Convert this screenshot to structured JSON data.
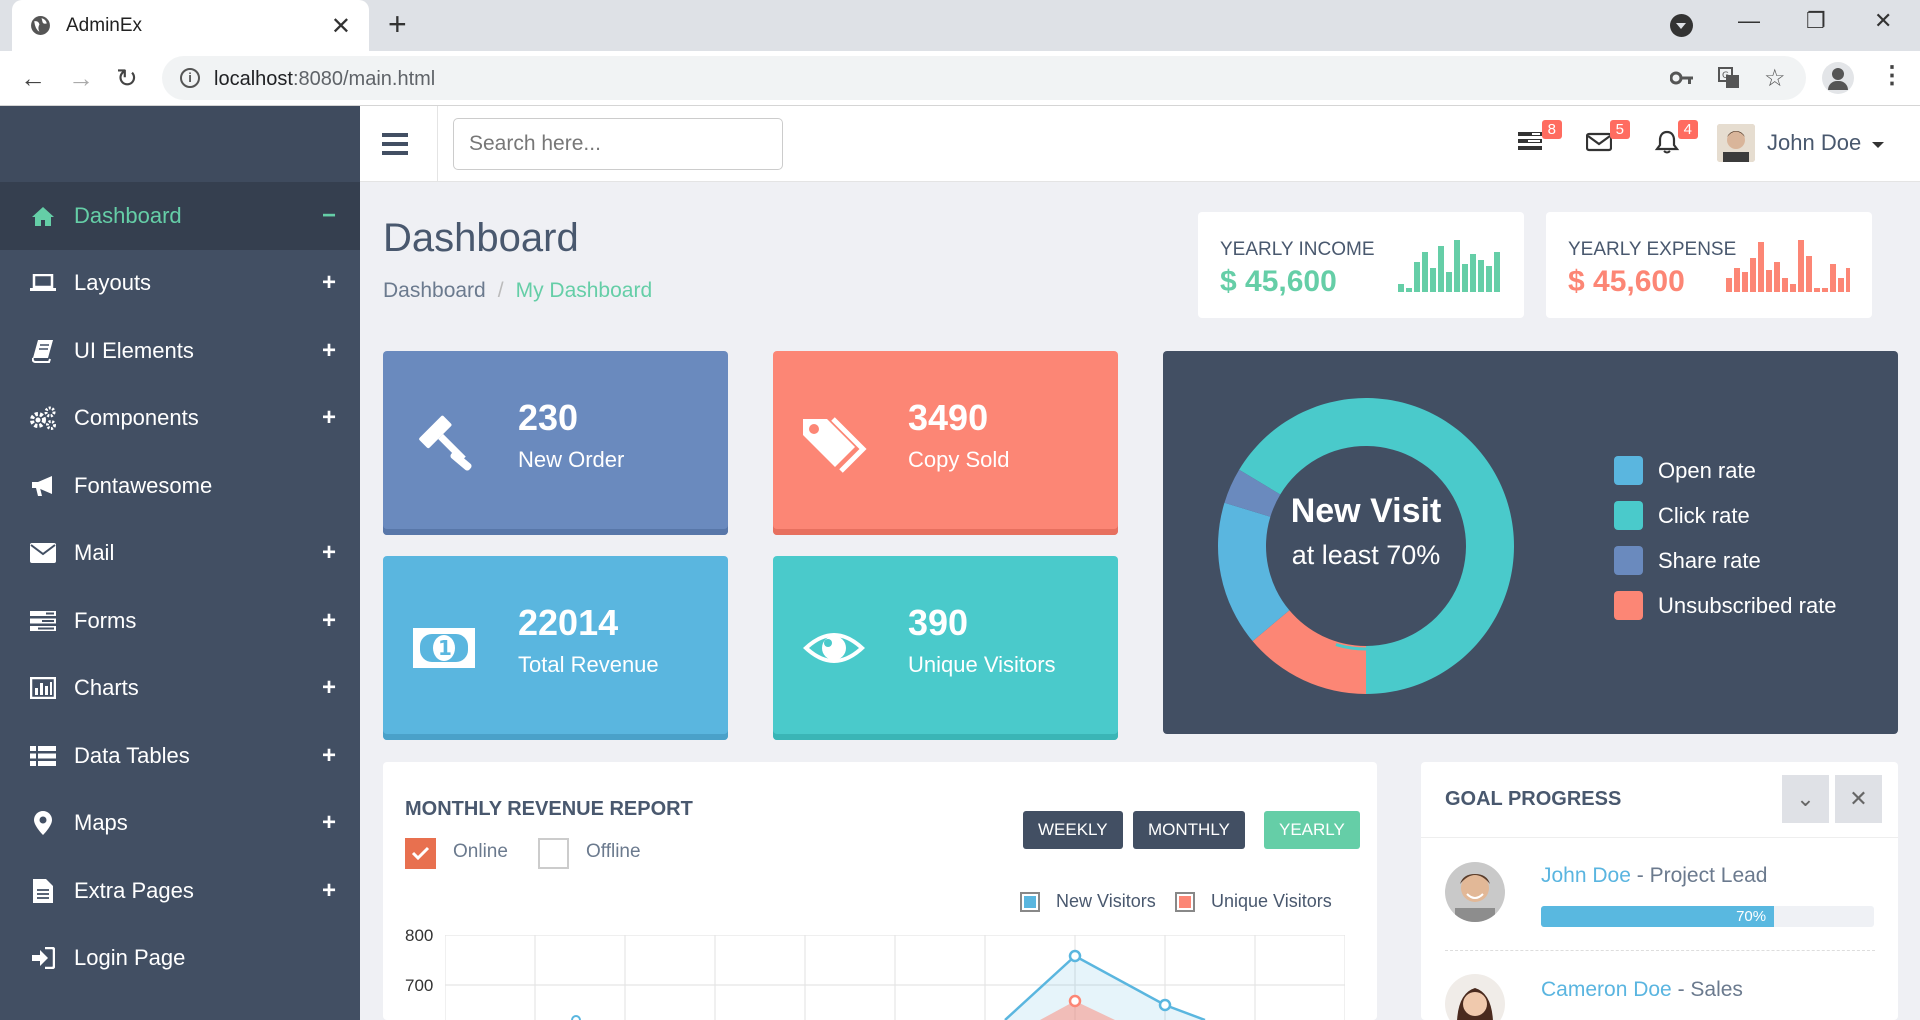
{
  "browser": {
    "tab_title": "AdminEx",
    "url_host": "localhost",
    "url_path": ":8080/main.html"
  },
  "sidebar": {
    "items": [
      {
        "label": "Dashboard",
        "icon": "home-icon",
        "toggle": "−"
      },
      {
        "label": "Layouts",
        "icon": "laptop-icon",
        "toggle": "+"
      },
      {
        "label": "UI Elements",
        "icon": "book-icon",
        "toggle": "+"
      },
      {
        "label": "Components",
        "icon": "cogs-icon",
        "toggle": "+"
      },
      {
        "label": "Fontawesome",
        "icon": "bullhorn-icon",
        "toggle": ""
      },
      {
        "label": "Mail",
        "icon": "envelope-icon",
        "toggle": "+"
      },
      {
        "label": "Forms",
        "icon": "tasks-icon",
        "toggle": "+"
      },
      {
        "label": "Charts",
        "icon": "bar-chart-icon",
        "toggle": "+"
      },
      {
        "label": "Data Tables",
        "icon": "table-icon",
        "toggle": "+"
      },
      {
        "label": "Maps",
        "icon": "map-marker-icon",
        "toggle": "+"
      },
      {
        "label": "Extra Pages",
        "icon": "file-icon",
        "toggle": "+"
      },
      {
        "label": "Login Page",
        "icon": "sign-in-icon",
        "toggle": ""
      }
    ]
  },
  "header": {
    "search_placeholder": "Search here...",
    "badges": {
      "tasks": "8",
      "mail": "5",
      "notifications": "4"
    },
    "user_name": "John Doe"
  },
  "page": {
    "title": "Dashboard",
    "breadcrumb": [
      "Dashboard",
      "My Dashboard"
    ],
    "breadcrumb_sep": "/"
  },
  "summary": {
    "income": {
      "label": "YEARLY INCOME",
      "value": "$ 45,600",
      "color": "#65cea7"
    },
    "expense": {
      "label": "YEARLY EXPENSE",
      "value": "$ 45,600",
      "color": "#fc8675"
    }
  },
  "tiles": [
    {
      "number": "230",
      "label": "New Order",
      "color": "#6a8abe",
      "icon": "gavel-icon"
    },
    {
      "number": "3490",
      "label": "Copy Sold",
      "color": "#fc8675",
      "icon": "tags-icon"
    },
    {
      "number": "22014",
      "label": "Total Revenue",
      "color": "#5ab6df",
      "icon": "money-icon"
    },
    {
      "number": "390",
      "label": "Unique Visitors",
      "color": "#4acacb",
      "icon": "eye-icon"
    }
  ],
  "visit": {
    "title": "New Visit",
    "subtitle": "at least 70%",
    "legend": [
      {
        "label": "Open rate",
        "color": "#5ab6df"
      },
      {
        "label": "Click rate",
        "color": "#4acacb"
      },
      {
        "label": "Share rate",
        "color": "#6a8abe"
      },
      {
        "label": "Unsubscribed rate",
        "color": "#fc8675"
      }
    ]
  },
  "revenue": {
    "title": "MONTHLY REVENUE REPORT",
    "buttons": [
      "WEEKLY",
      "MONTHLY",
      "YEARLY"
    ],
    "checks": [
      {
        "label": "Online",
        "checked": true
      },
      {
        "label": "Offline",
        "checked": false
      }
    ],
    "legend": [
      {
        "label": "New Visitors",
        "color": "#5ab6df"
      },
      {
        "label": "Unique Visitors",
        "color": "#fc8675"
      }
    ],
    "y_ticks": [
      "800",
      "700"
    ]
  },
  "goal": {
    "title": "GOAL PROGRESS",
    "people": [
      {
        "name": "John Doe",
        "role": " - Project Lead",
        "progress": "70%"
      },
      {
        "name": "Cameron Doe",
        "role": " - Sales"
      }
    ]
  }
}
